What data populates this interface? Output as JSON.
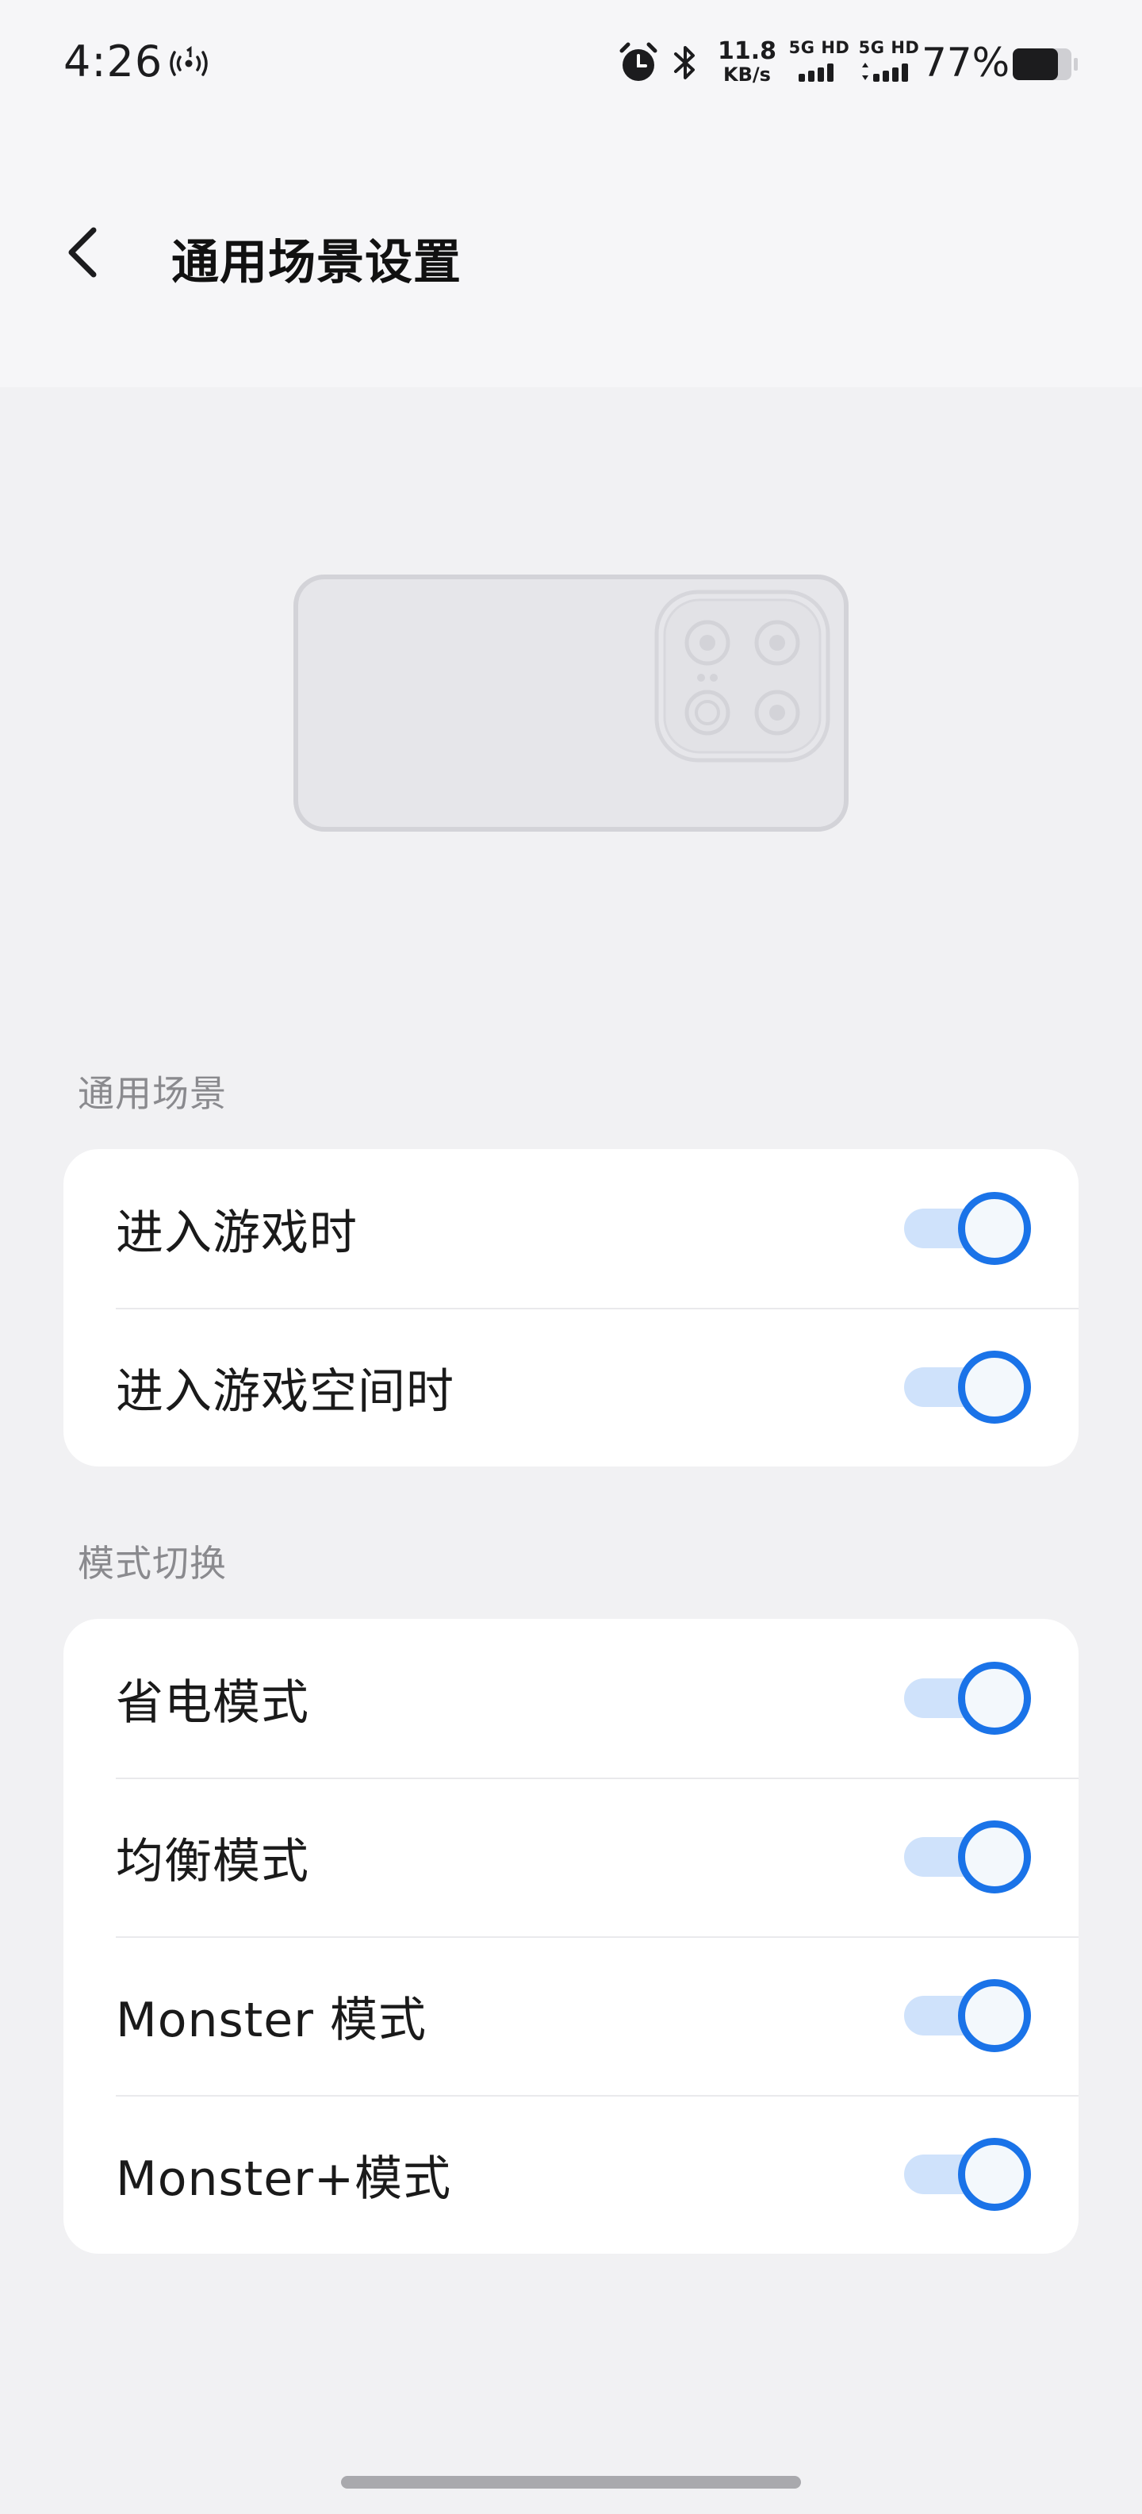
{
  "status_bar": {
    "time": "4:26",
    "net_speed_value": "11.8",
    "net_speed_unit": "KB/s",
    "sim1_label": "5G HD",
    "sim2_label": "5G HD",
    "battery_percent": "77%",
    "battery_level": 0.77,
    "icons": [
      "hotspot-icon",
      "alarm-icon",
      "bluetooth-icon",
      "signal-icon",
      "battery-icon"
    ]
  },
  "top_bar": {
    "title": "通用场景设置",
    "back_icon": "chevron-left-icon"
  },
  "sections": [
    {
      "title": "通用场景",
      "items": [
        {
          "label": "进入游戏时",
          "enabled": true
        },
        {
          "label": "进入游戏空间时",
          "enabled": true
        }
      ]
    },
    {
      "title": "模式切换",
      "items": [
        {
          "label": "省电模式",
          "enabled": true
        },
        {
          "label": "均衡模式",
          "enabled": true
        },
        {
          "label": "Monster 模式",
          "enabled": true
        },
        {
          "label": "Monster+模式",
          "enabled": true
        }
      ]
    }
  ],
  "colors": {
    "accent": "#1a73e8",
    "toggle_track_on": "#cfe2fb",
    "page_background": "#f1f1f3",
    "card_background": "#ffffff"
  }
}
